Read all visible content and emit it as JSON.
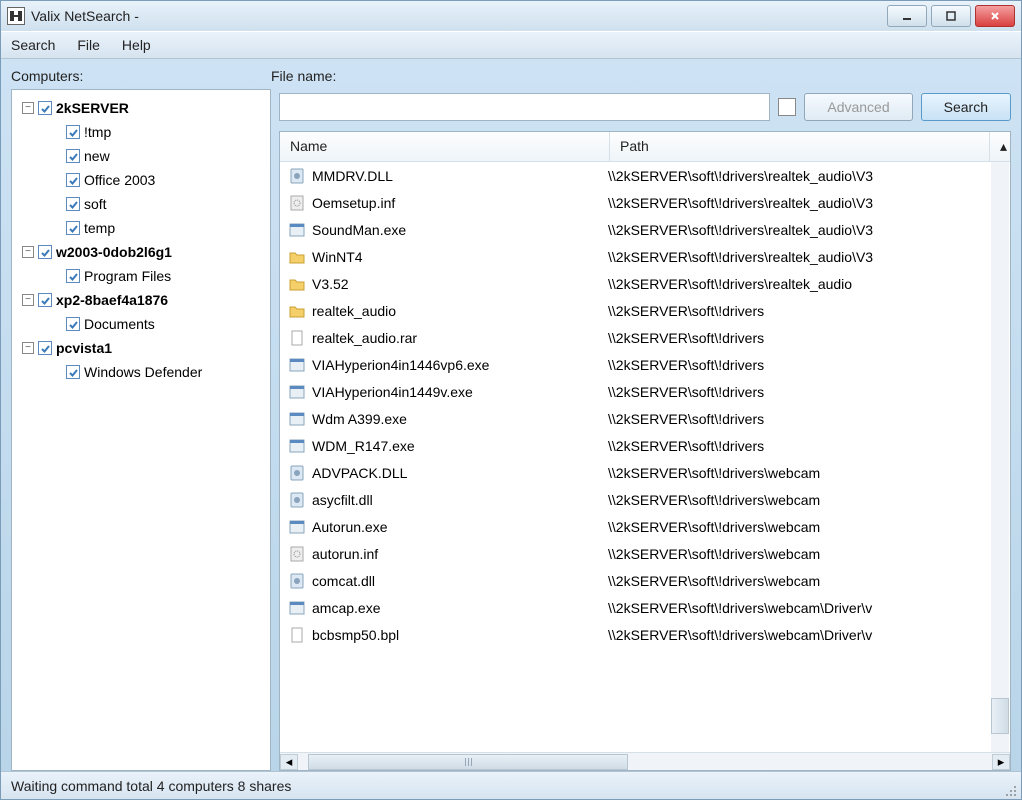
{
  "window_title": "Valix NetSearch -",
  "menu": {
    "search": "Search",
    "file": "File",
    "help": "Help"
  },
  "labels": {
    "computers": "Computers:",
    "filename": "File name:"
  },
  "search_bar": {
    "value": "",
    "advanced": "Advanced",
    "search": "Search"
  },
  "tree": [
    {
      "level": 0,
      "toggle": "-",
      "bold": true,
      "label": "2kSERVER"
    },
    {
      "level": 1,
      "toggle": "",
      "bold": false,
      "label": "!tmp"
    },
    {
      "level": 1,
      "toggle": "",
      "bold": false,
      "label": "new"
    },
    {
      "level": 1,
      "toggle": "",
      "bold": false,
      "label": "Office 2003"
    },
    {
      "level": 1,
      "toggle": "",
      "bold": false,
      "label": "soft"
    },
    {
      "level": 1,
      "toggle": "",
      "bold": false,
      "label": "temp"
    },
    {
      "level": 0,
      "toggle": "-",
      "bold": true,
      "label": "w2003-0dob2l6g1"
    },
    {
      "level": 1,
      "toggle": "",
      "bold": false,
      "label": "Program Files"
    },
    {
      "level": 0,
      "toggle": "-",
      "bold": true,
      "label": "xp2-8baef4a1876"
    },
    {
      "level": 1,
      "toggle": "",
      "bold": false,
      "label": "Documents"
    },
    {
      "level": 0,
      "toggle": "-",
      "bold": true,
      "label": "pcvista1"
    },
    {
      "level": 1,
      "toggle": "",
      "bold": false,
      "label": "Windows Defender"
    }
  ],
  "columns": {
    "name": "Name",
    "path": "Path"
  },
  "rows": [
    {
      "icon": "dll",
      "name": "MMDRV.DLL",
      "path": "\\\\2kSERVER\\soft\\!drivers\\realtek_audio\\V3"
    },
    {
      "icon": "inf",
      "name": "Oemsetup.inf",
      "path": "\\\\2kSERVER\\soft\\!drivers\\realtek_audio\\V3"
    },
    {
      "icon": "exe",
      "name": "SoundMan.exe",
      "path": "\\\\2kSERVER\\soft\\!drivers\\realtek_audio\\V3"
    },
    {
      "icon": "folder",
      "name": "WinNT4",
      "path": "\\\\2kSERVER\\soft\\!drivers\\realtek_audio\\V3"
    },
    {
      "icon": "folder",
      "name": "V3.52",
      "path": "\\\\2kSERVER\\soft\\!drivers\\realtek_audio"
    },
    {
      "icon": "folder",
      "name": "realtek_audio",
      "path": "\\\\2kSERVER\\soft\\!drivers"
    },
    {
      "icon": "file",
      "name": "realtek_audio.rar",
      "path": "\\\\2kSERVER\\soft\\!drivers"
    },
    {
      "icon": "exe",
      "name": "VIAHyperion4in1446vp6.exe",
      "path": "\\\\2kSERVER\\soft\\!drivers"
    },
    {
      "icon": "exe",
      "name": "VIAHyperion4in1449v.exe",
      "path": "\\\\2kSERVER\\soft\\!drivers"
    },
    {
      "icon": "exe",
      "name": "Wdm A399.exe",
      "path": "\\\\2kSERVER\\soft\\!drivers"
    },
    {
      "icon": "exe",
      "name": "WDM_R147.exe",
      "path": "\\\\2kSERVER\\soft\\!drivers"
    },
    {
      "icon": "dll",
      "name": "ADVPACK.DLL",
      "path": "\\\\2kSERVER\\soft\\!drivers\\webcam"
    },
    {
      "icon": "dll",
      "name": "asycfilt.dll",
      "path": "\\\\2kSERVER\\soft\\!drivers\\webcam"
    },
    {
      "icon": "exe",
      "name": "Autorun.exe",
      "path": "\\\\2kSERVER\\soft\\!drivers\\webcam"
    },
    {
      "icon": "inf",
      "name": "autorun.inf",
      "path": "\\\\2kSERVER\\soft\\!drivers\\webcam"
    },
    {
      "icon": "dll",
      "name": "comcat.dll",
      "path": "\\\\2kSERVER\\soft\\!drivers\\webcam"
    },
    {
      "icon": "exe",
      "name": "amcap.exe",
      "path": "\\\\2kSERVER\\soft\\!drivers\\webcam\\Driver\\v"
    },
    {
      "icon": "file",
      "name": "bcbsmp50.bpl",
      "path": "\\\\2kSERVER\\soft\\!drivers\\webcam\\Driver\\v"
    }
  ],
  "status": "Waiting command  total 4 computers 8 shares"
}
